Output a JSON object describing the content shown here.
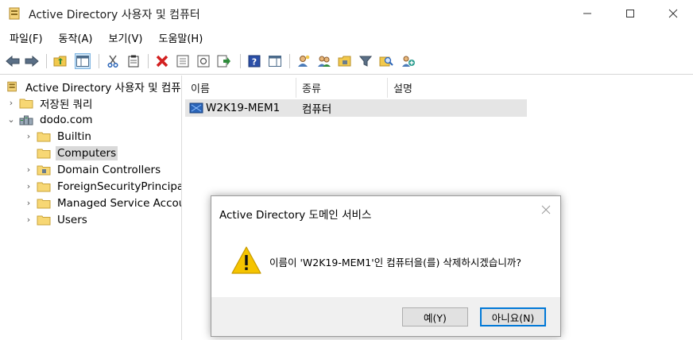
{
  "window": {
    "title": "Active Directory 사용자 및 컴퓨터"
  },
  "menu": [
    "파일(F)",
    "동작(A)",
    "보기(V)",
    "도움말(H)"
  ],
  "tree": {
    "root": "Active Directory 사용자 및 컴퓨터",
    "saved_queries": "저장된 쿼리",
    "domain": "dodo.com",
    "children": [
      "Builtin",
      "Computers",
      "Domain Controllers",
      "ForeignSecurityPrincipals",
      "Managed Service Accounts",
      "Users"
    ],
    "selected": "Computers"
  },
  "list": {
    "columns": [
      "이름",
      "종류",
      "설명"
    ],
    "rows": [
      {
        "name": "W2K19-MEM1",
        "type": "컴퓨터",
        "description": ""
      }
    ]
  },
  "dialog": {
    "title": "Active Directory 도메인 서비스",
    "message": "이름이 'W2K19-MEM1'인 컴퓨터을(를) 삭제하시겠습니까?",
    "yes_label": "예(Y)",
    "no_label": "아니요(N)"
  },
  "colors": {
    "selection_gray": "#d9d9d9",
    "row_highlight": "#e5e5e5",
    "default_button_border": "#0078d7",
    "warning_yellow": "#f5c400"
  }
}
